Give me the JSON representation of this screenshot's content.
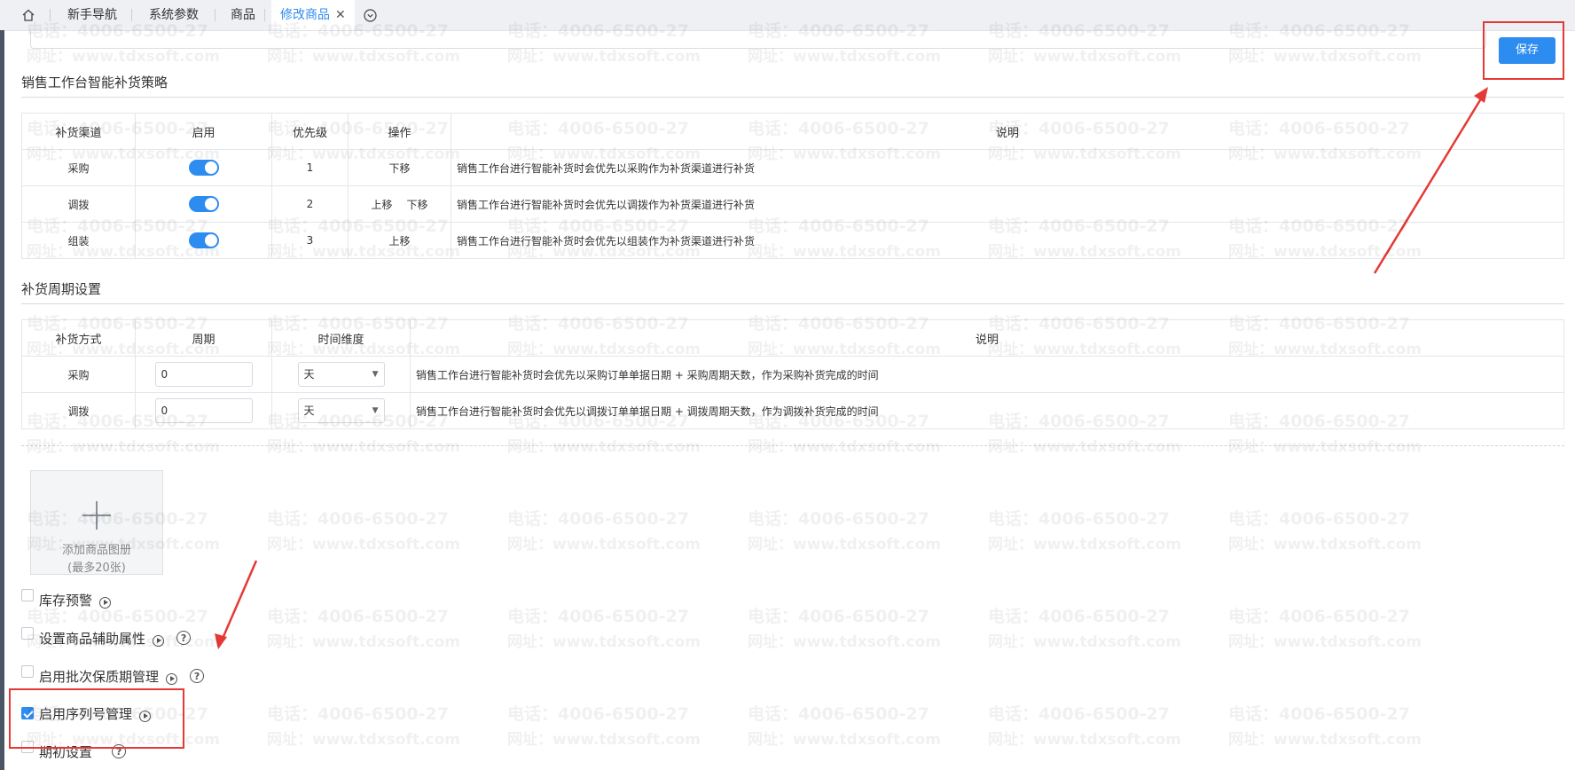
{
  "tabs": {
    "home_icon": "home-icon",
    "items": [
      {
        "label": "新手导航"
      },
      {
        "label": "系统参数"
      },
      {
        "label": "商品"
      },
      {
        "label": "修改商品",
        "active": true
      }
    ],
    "close_icon": "close-icon",
    "more_icon": "chevron-down-circle-icon"
  },
  "toolbar": {
    "save_label": "保存"
  },
  "strategy": {
    "title": "销售工作台智能补货策略",
    "headers": [
      "补货渠道",
      "启用",
      "优先级",
      "操作",
      "说明"
    ],
    "rows": [
      {
        "channel": "采购",
        "enabled": true,
        "priority": "1",
        "ops": [
          "下移"
        ],
        "desc": "销售工作台进行智能补货时会优先以采购作为补货渠道进行补货"
      },
      {
        "channel": "调拨",
        "enabled": true,
        "priority": "2",
        "ops": [
          "上移",
          "下移"
        ],
        "desc": "销售工作台进行智能补货时会优先以调拨作为补货渠道进行补货"
      },
      {
        "channel": "组装",
        "enabled": true,
        "priority": "3",
        "ops": [
          "上移"
        ],
        "desc": "销售工作台进行智能补货时会优先以组装作为补货渠道进行补货"
      }
    ]
  },
  "cycle": {
    "title": "补货周期设置",
    "headers": [
      "补货方式",
      "周期",
      "时间维度",
      "说明"
    ],
    "rows": [
      {
        "method": "采购",
        "period": "0",
        "unit": "天",
        "desc": "销售工作台进行智能补货时会优先以采购订单单据日期 + 采购周期天数，作为采购补货完成的时间"
      },
      {
        "method": "调拨",
        "period": "0",
        "unit": "天",
        "desc": "销售工作台进行智能补货时会优先以调拨订单单据日期 + 调拨周期天数，作为调拨补货完成的时间"
      }
    ]
  },
  "upload": {
    "line1": "添加商品图册",
    "line2": "(最多20张)"
  },
  "options": [
    {
      "label": "库存预警",
      "checked": false,
      "play": true,
      "help": false
    },
    {
      "label": "设置商品辅助属性",
      "checked": false,
      "play": true,
      "help": true
    },
    {
      "label": "启用批次保质期管理",
      "checked": false,
      "play": true,
      "help": true
    },
    {
      "label": "启用序列号管理",
      "checked": true,
      "play": true,
      "help": false
    },
    {
      "label": "期初设置",
      "checked": false,
      "play": false,
      "help": true
    }
  ],
  "watermark": {
    "phone": "电话：4006-6500-27",
    "site": "网址：www.tdxsoft.com"
  },
  "colors": {
    "accent": "#2d8cf0",
    "annotation": "#e53935"
  }
}
